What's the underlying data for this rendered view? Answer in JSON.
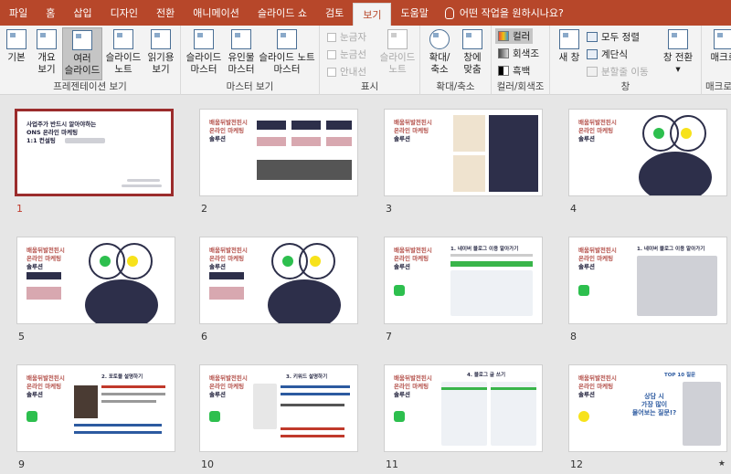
{
  "tabs": [
    "파일",
    "홈",
    "삽입",
    "디자인",
    "전환",
    "애니메이션",
    "슬라이드 쇼",
    "검토",
    "보기",
    "도움말"
  ],
  "active_tab": "보기",
  "tell_me": "어떤 작업을 원하시나요?",
  "groups": {
    "presentation_views": {
      "label": "프레젠테이션 보기",
      "buttons": [
        {
          "l1": "기본",
          "l2": ""
        },
        {
          "l1": "개요",
          "l2": "보기"
        },
        {
          "l1": "여러",
          "l2": "슬라이드"
        },
        {
          "l1": "슬라이드",
          "l2": "노트"
        },
        {
          "l1": "읽기용",
          "l2": "보기"
        }
      ]
    },
    "master_views": {
      "label": "마스터 보기",
      "buttons": [
        {
          "l1": "슬라이드",
          "l2": "마스터"
        },
        {
          "l1": "유인물",
          "l2": "마스터"
        },
        {
          "l1": "슬라이드 노트",
          "l2": "마스터"
        }
      ]
    },
    "show": {
      "label": "표시",
      "checks": [
        "눈금자",
        "눈금선",
        "안내선"
      ],
      "notes": {
        "l1": "슬라이드",
        "l2": "노트"
      }
    },
    "zoom": {
      "label": "확대/축소",
      "buttons": [
        {
          "l1": "확대/",
          "l2": "축소"
        },
        {
          "l1": "창에",
          "l2": "맞춤"
        }
      ]
    },
    "color": {
      "label": "컬러/회색조",
      "items": [
        "컬러",
        "회색조",
        "흑백"
      ]
    },
    "window": {
      "label": "창",
      "new_window": "새 창",
      "arrange_all": "모두 정렬",
      "cascade": "계단식",
      "move_split": "분할줄 이동",
      "switch": {
        "l1": "창 전환",
        "l2": "▾"
      }
    },
    "macro": {
      "label": "매크로",
      "button": "매크로"
    }
  },
  "slides": [
    {
      "num": "1",
      "title1": "사업주가 반드시 알아야하는",
      "title2": "ONS 온라인 마케팅",
      "title3": "1:1 컨설팅"
    },
    {
      "num": "2"
    },
    {
      "num": "3"
    },
    {
      "num": "4"
    },
    {
      "num": "5"
    },
    {
      "num": "6"
    },
    {
      "num": "7",
      "heading": "1. 네이버 블로그 이용 알아가기"
    },
    {
      "num": "8",
      "heading": "1. 네이버 블로그 이용 알아가기"
    },
    {
      "num": "9",
      "heading": "2. 포토블 설명하기"
    },
    {
      "num": "10",
      "heading": "3. 키워드 설명하기"
    },
    {
      "num": "11",
      "heading": "4. 블로그 글 쓰기"
    },
    {
      "num": "12",
      "heading": "TOP 10 질문",
      "callout1": "상담 시",
      "callout2": "가장 많이",
      "callout3": "물어보는 질문!?"
    }
  ],
  "thumb_common": {
    "line1": "배움뒤발전된시",
    "line2": "온라인 마케팅",
    "line3": "솔루션"
  },
  "accent": "#b7472a"
}
